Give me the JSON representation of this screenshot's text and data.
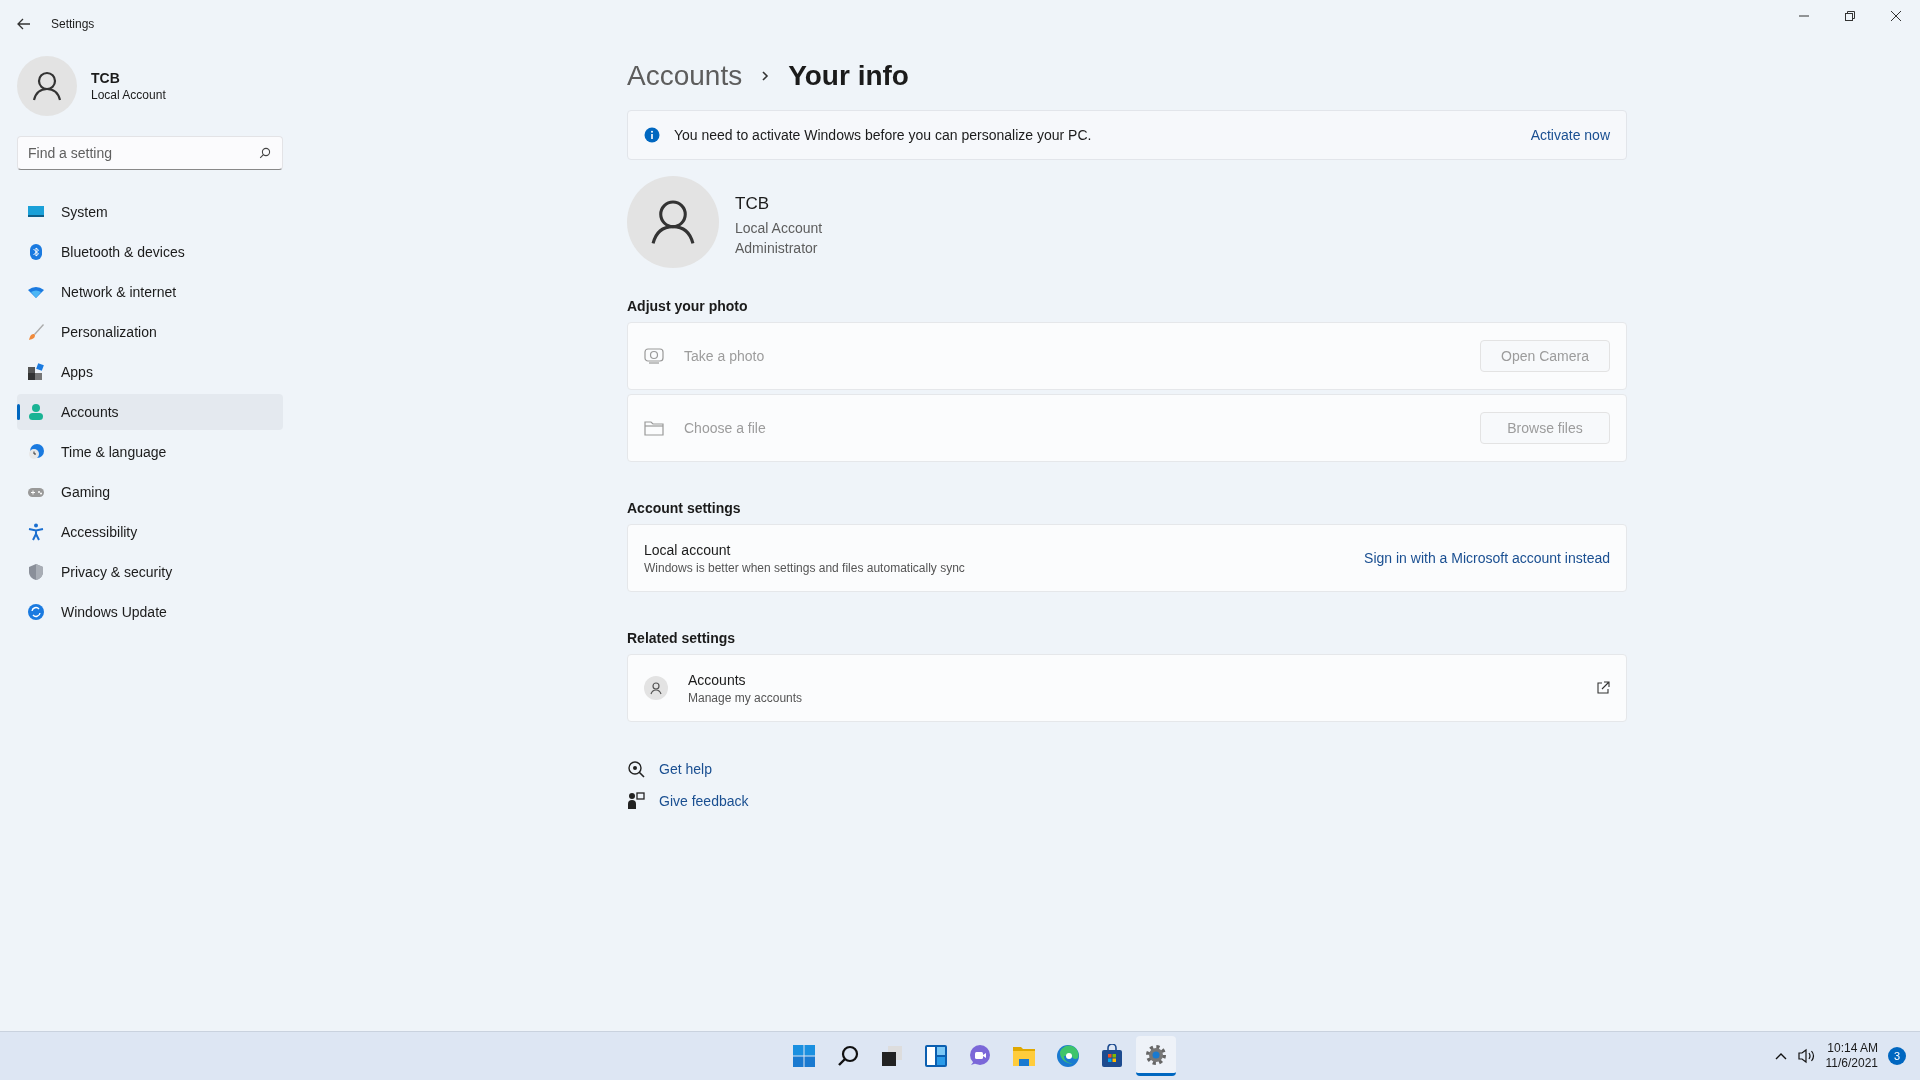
{
  "window": {
    "title": "Settings"
  },
  "profile": {
    "name": "TCB",
    "account_type": "Local Account"
  },
  "search": {
    "placeholder": "Find a setting"
  },
  "nav": [
    {
      "label": "System",
      "selected": false
    },
    {
      "label": "Bluetooth & devices",
      "selected": false
    },
    {
      "label": "Network & internet",
      "selected": false
    },
    {
      "label": "Personalization",
      "selected": false
    },
    {
      "label": "Apps",
      "selected": false
    },
    {
      "label": "Accounts",
      "selected": true
    },
    {
      "label": "Time & language",
      "selected": false
    },
    {
      "label": "Gaming",
      "selected": false
    },
    {
      "label": "Accessibility",
      "selected": false
    },
    {
      "label": "Privacy & security",
      "selected": false
    },
    {
      "label": "Windows Update",
      "selected": false
    }
  ],
  "breadcrumb": {
    "parent": "Accounts",
    "current": "Your info"
  },
  "banner": {
    "message": "You need to activate Windows before you can personalize your PC.",
    "action": "Activate now"
  },
  "user": {
    "name": "TCB",
    "lines": [
      "Local Account",
      "Administrator"
    ]
  },
  "photo_section": {
    "heading": "Adjust your photo",
    "rows": [
      {
        "label": "Take a photo",
        "button": "Open Camera",
        "disabled": true
      },
      {
        "label": "Choose a file",
        "button": "Browse files",
        "disabled": true
      }
    ]
  },
  "account_settings": {
    "heading": "Account settings",
    "title": "Local account",
    "description": "Windows is better when settings and files automatically sync",
    "link": "Sign in with a Microsoft account instead"
  },
  "related": {
    "heading": "Related settings",
    "items": [
      {
        "title": "Accounts",
        "subtitle": "Manage my accounts"
      }
    ]
  },
  "help_links": [
    "Get help",
    "Give feedback"
  ],
  "taskbar": {
    "apps": [
      {
        "selected": false
      },
      {
        "selected": false
      },
      {
        "selected": false
      },
      {
        "selected": false
      },
      {
        "selected": false
      },
      {
        "selected": false
      },
      {
        "selected": false
      },
      {
        "selected": false
      },
      {
        "selected": true
      }
    ]
  },
  "tray": {
    "time": "10:14 AM",
    "date": "11/6/2021",
    "notifications": "3"
  }
}
